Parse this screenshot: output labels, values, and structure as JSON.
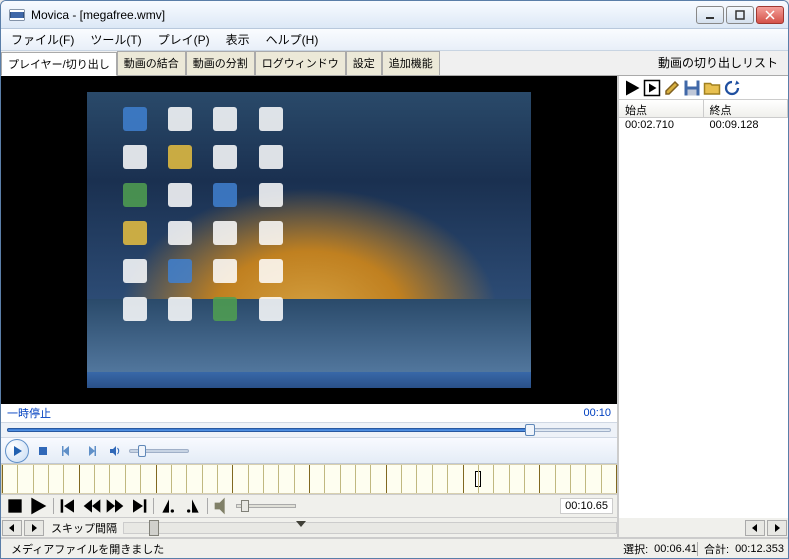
{
  "window_title": "Movica - [megafree.wmv]",
  "menubar": [
    "ファイル(F)",
    "ツール(T)",
    "プレイ(P)",
    "表示",
    "ヘルプ(H)"
  ],
  "tabs": [
    "プレイヤー/切り出し",
    "動画の結合",
    "動画の分割",
    "ログウィンドウ",
    "設定",
    "追加機能"
  ],
  "right_panel_title": "動画の切り出しリスト",
  "list_columns": [
    "始点",
    "終点"
  ],
  "list_row": {
    "start": "00:02.710",
    "end": "00:09.128"
  },
  "pause_label": "一時停止",
  "pause_time": "00:10",
  "lower_time": "00:10.65",
  "skip_label": "スキップ間隔",
  "status_msg": "メディアファイルを開きました",
  "status_selection_label": "選択:",
  "status_selection": "00:06.41",
  "status_total_label": "合計:",
  "status_total": "00:12.353",
  "right_toolbar_icons": [
    "play-icon",
    "play-skip-icon",
    "edit-icon",
    "save-icon",
    "folder-open-icon",
    "refresh-icon"
  ]
}
